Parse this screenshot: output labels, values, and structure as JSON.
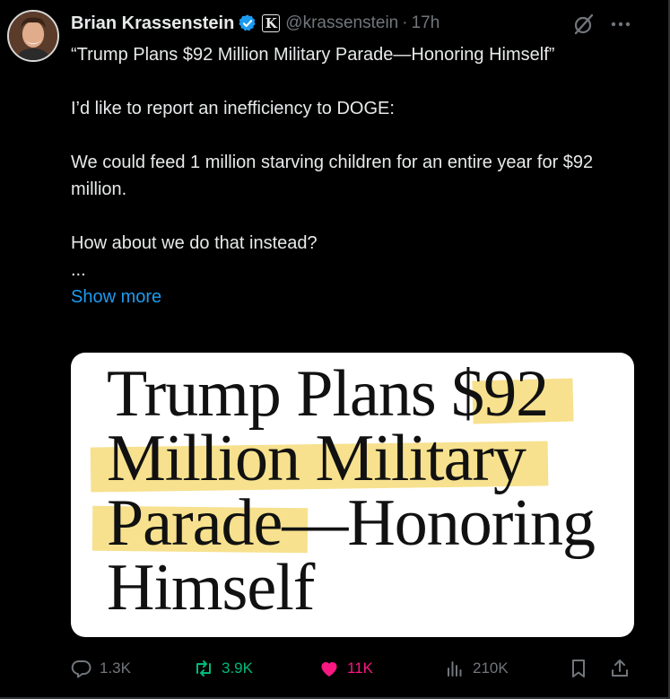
{
  "author": {
    "name": "Brian Krassenstein",
    "affiliate_badge": "K",
    "handle": "@krassenstein",
    "separator": "·",
    "timestamp": "17h",
    "avatar_icon": "profile-photo"
  },
  "tweet": {
    "lines": [
      "“Trump Plans $92 Million Military Parade—Honoring Himself”",
      "",
      "I’d like to report an inefficiency to DOGE:",
      "",
      "We could feed 1 million starving children for an entire year for $92 million.",
      "",
      "How about we do that instead?",
      "..."
    ],
    "quote_line": "“Trump Plans $92 Million Military Parade—Honoring Himself”",
    "report_line": "I’d like to report an inefficiency to DOGE:",
    "feed_line": "We could feed 1 million starving children for an entire year for $92 million.",
    "question_line": "How about we do that instead?",
    "ellipsis": "...",
    "show_more": "Show more"
  },
  "card": {
    "headline_line1": "Trump Plans $92",
    "headline_line2": "Million Military",
    "headline_line3": "Parade—Honoring",
    "headline_line4": "Himself",
    "highlight_color": "#f6dc7a"
  },
  "actions": {
    "replies": "1.3K",
    "reposts": "3.9K",
    "likes": "11K",
    "views": "210K",
    "colors": {
      "default": "#71767b",
      "repost": "#00ba7c",
      "like": "#f91880",
      "verified": "#1d9bf0"
    }
  }
}
